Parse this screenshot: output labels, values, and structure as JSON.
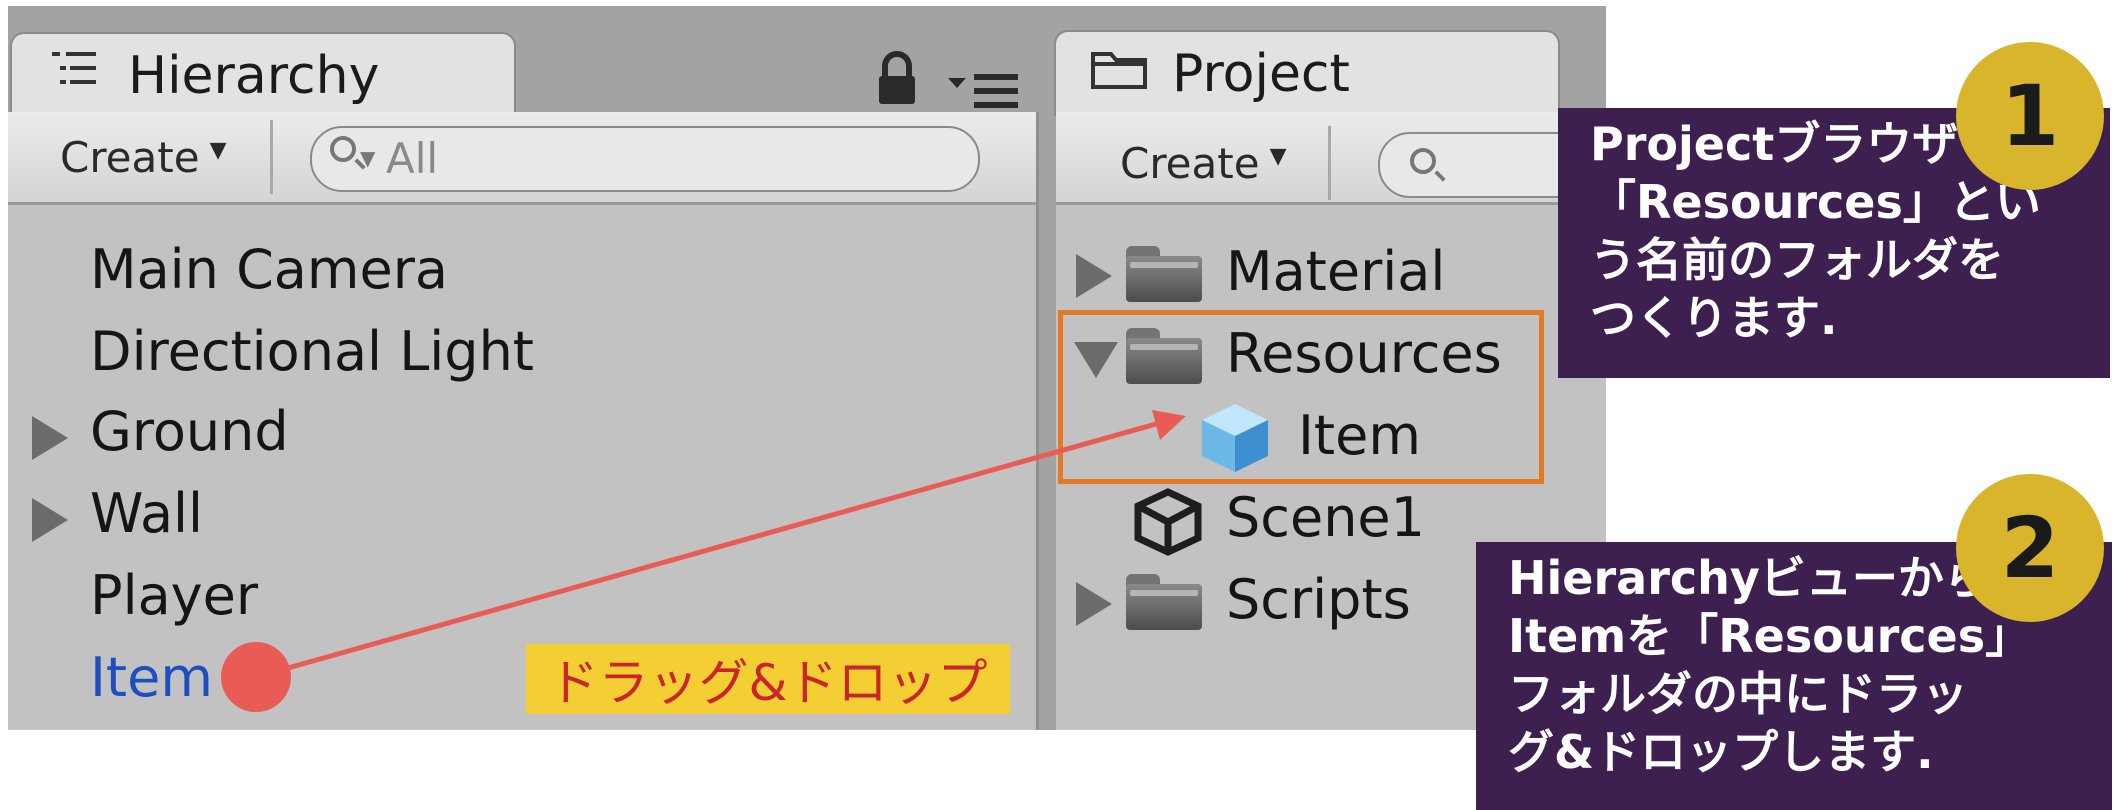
{
  "hierarchy": {
    "tab_label": "Hierarchy",
    "create_label": "Create",
    "search_placeholder": "All",
    "items": [
      "Main Camera",
      "Directional Light",
      "Ground",
      "Wall",
      "Player",
      "Item"
    ]
  },
  "project": {
    "tab_label": "Project",
    "create_label": "Create",
    "items": [
      "Material",
      "Resources",
      "Item",
      "Scene1",
      "Scripts"
    ]
  },
  "annotations": {
    "drag_label": "ドラッグ&ドロップ",
    "step1": {
      "number": "1",
      "lines": [
        "Projectブラウザ",
        "「Resources」とい",
        "う名前のフォルダを",
        "つくります."
      ]
    },
    "step2": {
      "number": "2",
      "lines": [
        "Hierarchyビューから",
        "Itemを「Resources」",
        "フォルダの中にドラッ",
        "グ&ドロップします."
      ]
    }
  },
  "colors": {
    "highlight_box": "#e17a22",
    "arrow": "#e85c55",
    "callout_bg": "#3e2050",
    "badge": "#d8b52a",
    "drag_label_bg": "#f4cf34",
    "drag_label_text": "#c9252a",
    "selected_item": "#1f4fbf"
  }
}
